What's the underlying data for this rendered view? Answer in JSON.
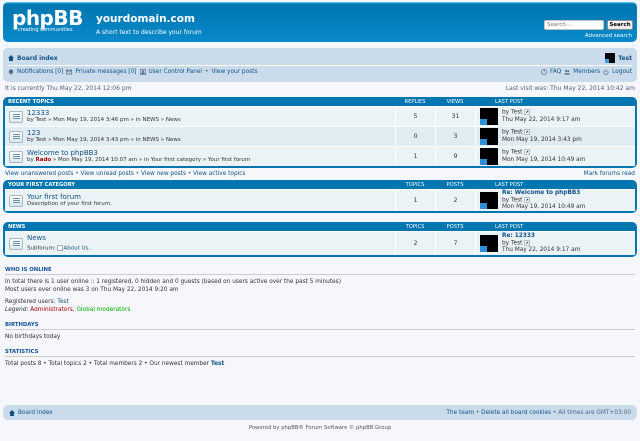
{
  "header": {
    "logo_text": "phpBB",
    "logo_tagline": "creating communities",
    "site_title": "yourdomain.com",
    "site_description": "A short text to describe your forum",
    "search_placeholder": "Search…",
    "search_button": "Search",
    "advanced_search": "Advanced search"
  },
  "navbar": {
    "board_index": "Board index",
    "user_name": "Test",
    "notifications": "Notifications [0]",
    "private_messages": "Private messages [0]",
    "ucp": "User Control Panel",
    "view_posts": "View your posts",
    "faq": "FAQ",
    "members": "Members",
    "logout": "Logout"
  },
  "time": {
    "current": "It is currently Thu May 22, 2014 12:06 pm",
    "last_visit": "Last visit was: Thu May 22, 2014 10:42 am"
  },
  "recent_topics": {
    "header": {
      "title": "Recent topics",
      "replies": "Replies",
      "views": "Views",
      "last_post": "Last post"
    },
    "rows": [
      {
        "title": "12333",
        "meta": "by Test » Mon May 19, 2014 3:46 pm » in NEWS » News",
        "replies": "5",
        "views": "31",
        "last_by": "by Test",
        "last_time": "Thu May 22, 2014 9:17 am"
      },
      {
        "title": "123",
        "meta": "by Test » Mon May 19, 2014 3:43 pm » in NEWS » News",
        "replies": "0",
        "views": "3",
        "last_by": "by Test",
        "last_time": "Mon May 19, 2014 3:43 pm"
      },
      {
        "title": "Welcome to phpBB3",
        "meta_by": "by ",
        "meta_user": "Rado",
        "meta_rest": " » Mon May 19, 2014 10:07 am » in Your first category » Your first forum",
        "replies": "1",
        "views": "9",
        "last_by": "by Test",
        "last_time": "Mon May 19, 2014 10:49 am"
      }
    ]
  },
  "links": {
    "unanswered": "View unanswered posts",
    "unread": "View unread posts",
    "new": "View new posts",
    "active": "View active topics",
    "mark_read": "Mark forums read"
  },
  "first_category": {
    "header": {
      "title": "Your first category",
      "topics": "Topics",
      "posts": "Posts",
      "last_post": "Last post"
    },
    "forum": {
      "title": "Your first forum",
      "desc": "Description of your first forum.",
      "topics": "1",
      "posts": "2",
      "last_title": "Re: Welcome to phpBB3",
      "last_by": "by Test",
      "last_time": "Mon May 19, 2014 10:49 am"
    }
  },
  "news_category": {
    "header": {
      "title": "News",
      "topics": "Topics",
      "posts": "Posts",
      "last_post": "Last post"
    },
    "forum": {
      "title": "News",
      "subforum_label": "Subforum:",
      "subforum": "About Us.",
      "topics": "2",
      "posts": "7",
      "last_title": "Re: 12333",
      "last_by": "by Test",
      "last_time": "Thu May 22, 2014 9:17 am"
    }
  },
  "who_is_online": {
    "title": "Who is online",
    "line1": "In total there is 1 user online :: 1 registered, 0 hidden and 0 guests (based on users active over the past 5 minutes)",
    "line2": "Most users ever online was 3 on Thu May 22, 2014 9:20 am",
    "registered_label": "Registered users:",
    "registered_user": "Test",
    "legend_label": "Legend:",
    "legend_admin": "Administrators",
    "legend_sep": ",",
    "legend_gm": "Global moderators"
  },
  "birthdays": {
    "title": "Birthdays",
    "text": "No birthdays today"
  },
  "statistics": {
    "title": "Statistics",
    "text": "Total posts 8 • Total topics 2 • Total members 2 • Our newest member",
    "newest": "Test"
  },
  "footer": {
    "board_index": "Board index",
    "team": "The team",
    "delete_cookies": "Delete all board cookies",
    "timezone": "All times are GMT+03:00",
    "sep": "•",
    "powered": "Powered by phpBB® Forum Software © phpBB Group"
  }
}
